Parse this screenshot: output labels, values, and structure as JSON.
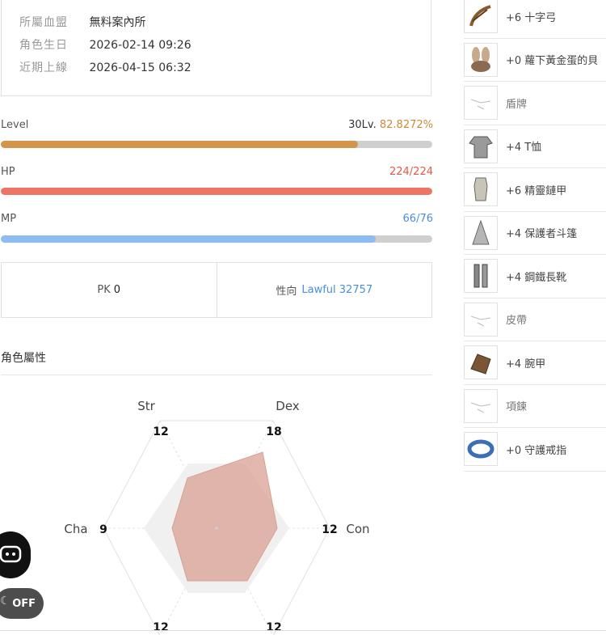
{
  "profile": {
    "rows": [
      {
        "key": "所屬血盟",
        "value": "無料案內所"
      },
      {
        "key": "角色生日",
        "value": "2026-02-14 09:26"
      },
      {
        "key": "近期上線",
        "value": "2026-04-15 06:32"
      }
    ]
  },
  "stats": {
    "level": {
      "label": "Level",
      "level_text": "30Lv.",
      "percent_text": "82.8272%",
      "progress": 0.828,
      "color": "#d4954a"
    },
    "hp": {
      "label": "HP",
      "value_text": "224/224",
      "progress": 1.0,
      "color": "#ee7563"
    },
    "mp": {
      "label": "MP",
      "value_text": "66/76",
      "progress": 0.868,
      "color": "#8fbcf0"
    }
  },
  "pk": {
    "label": "PK",
    "value": "0",
    "alignment_label": "性向",
    "alignment_value": "Lawful 32757"
  },
  "attributes": {
    "title": "角色屬性",
    "labels": {
      "str": "Str",
      "dex": "Dex",
      "con": "Con",
      "cha": "Cha"
    },
    "values": {
      "str": "12",
      "dex": "18",
      "con": "12",
      "wis": "12",
      "int": "12",
      "cha": "9"
    }
  },
  "equipment": [
    {
      "name": "+6 十字弓",
      "icon": "crossbow-icon"
    },
    {
      "name": "+0 蘿下黃金蛋的貝",
      "icon": "bunny-hat-icon"
    },
    {
      "name": "盾牌",
      "icon": "empty-slot-icon",
      "empty": true
    },
    {
      "name": "+4 T恤",
      "icon": "tshirt-icon"
    },
    {
      "name": "+6 精靈鏈甲",
      "icon": "chainmail-icon"
    },
    {
      "name": "+4 保護者斗篷",
      "icon": "cloak-icon"
    },
    {
      "name": "+4 鋼鐵長靴",
      "icon": "boots-icon"
    },
    {
      "name": "皮帶",
      "icon": "empty-slot-icon",
      "empty": true
    },
    {
      "name": "+4 腕甲",
      "icon": "glove-icon"
    },
    {
      "name": "項鍊",
      "icon": "empty-slot-icon",
      "empty": true
    },
    {
      "name": "+0 守護戒指",
      "icon": "ring-icon"
    }
  ],
  "floating": {
    "toggle_label": "OFF"
  }
}
